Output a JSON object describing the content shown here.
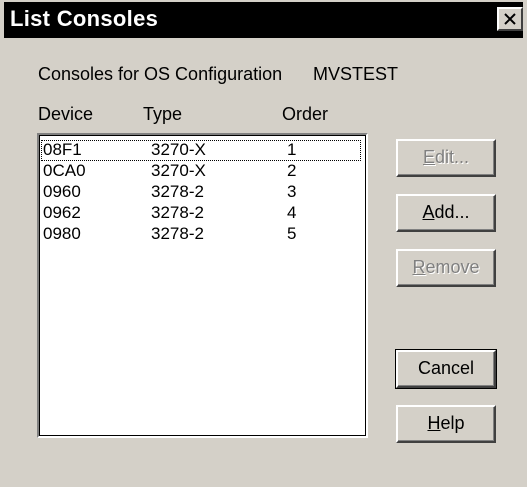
{
  "window": {
    "title": "List Consoles"
  },
  "header": {
    "consoles_for_label": "Consoles for OS Configuration",
    "config_name": "MVSTEST"
  },
  "columns": {
    "device": "Device",
    "type": "Type",
    "order": "Order"
  },
  "rows": [
    {
      "device": "08F1",
      "type": "3270-X",
      "order": "1"
    },
    {
      "device": "0CA0",
      "type": "3270-X",
      "order": "2"
    },
    {
      "device": "0960",
      "type": "3278-2",
      "order": "3"
    },
    {
      "device": "0962",
      "type": "3278-2",
      "order": "4"
    },
    {
      "device": "0980",
      "type": "3278-2",
      "order": "5"
    }
  ],
  "buttons": {
    "edit": {
      "mnemonic": "E",
      "rest": "dit..."
    },
    "add": {
      "mnemonic": "A",
      "rest": "dd..."
    },
    "remove": {
      "mnemonic": "R",
      "rest": "emove"
    },
    "cancel": {
      "label": "Cancel"
    },
    "help": {
      "mnemonic": "H",
      "rest": "elp"
    }
  },
  "icons": {
    "close": "close-icon"
  }
}
